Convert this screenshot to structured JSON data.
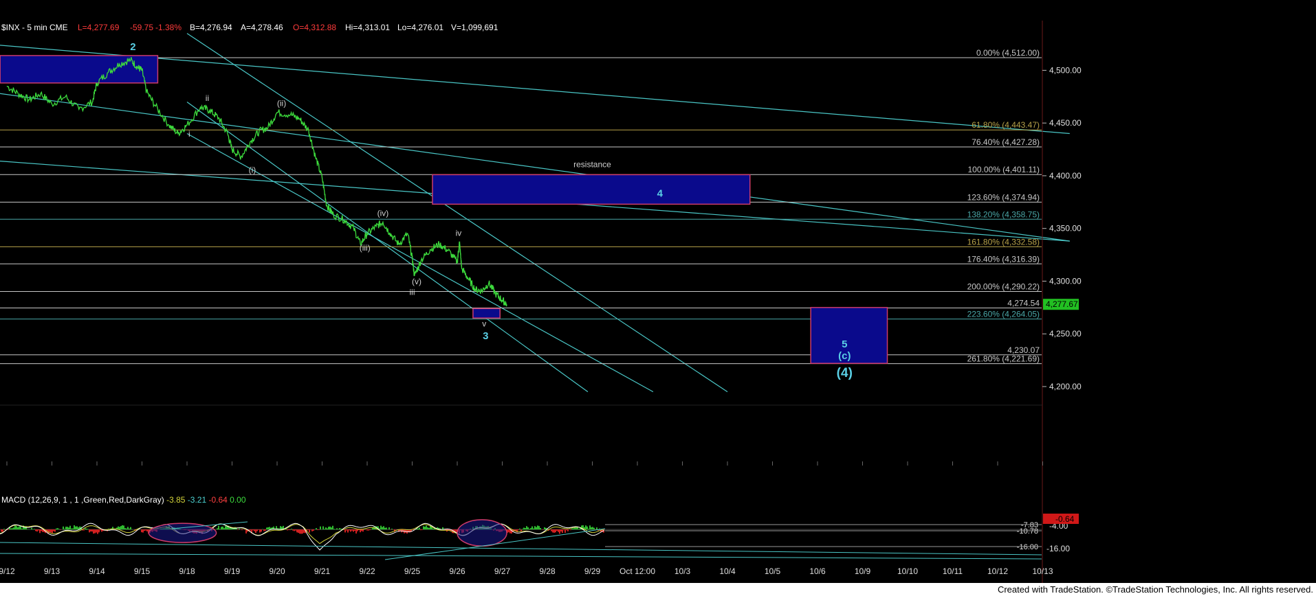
{
  "header": {
    "symbol": "$INX - 5 min  CME",
    "last": "L=4,277.69",
    "change": "-59.75",
    "pct": "-1.38%",
    "bid": "B=4,276.94",
    "ask": "A=4,278.46",
    "open": "O=4,312.88",
    "high": "Hi=4,313.01",
    "low": "Lo=4,276.01",
    "volume": "V=1,099,691"
  },
  "colors": {
    "background": "#000000",
    "price": "#3ddc3d",
    "trendline": "#4ac7c7",
    "fib": "#c8c8c8",
    "fib_gold": "#b7a24a",
    "box_fill": "#0a0a8c",
    "box_edge": "#cc3b6a",
    "wave_cyan": "#5ad0e6",
    "wave_white": "#d0d0d0"
  },
  "chart_data": {
    "type": "line",
    "title": "$INX - 5 min  CME",
    "x": [
      "9/12",
      "9/13",
      "9/14",
      "9/15",
      "9/18",
      "9/19",
      "9/20",
      "9/21",
      "9/22",
      "9/25",
      "9/26",
      "9/27",
      "9/28",
      "9/29",
      "Oct 12:00",
      "10/3",
      "10/4",
      "10/5",
      "10/6",
      "10/9",
      "10/10",
      "10/11",
      "10/12",
      "10/13"
    ],
    "series": [
      {
        "name": "$INX",
        "points": [
          [
            0.0,
            4485
          ],
          [
            0.25,
            4478
          ],
          [
            0.5,
            4472
          ],
          [
            0.75,
            4478
          ],
          [
            1.0,
            4468
          ],
          [
            1.3,
            4475
          ],
          [
            1.6,
            4463
          ],
          [
            1.9,
            4470
          ],
          [
            2.0,
            4488
          ],
          [
            2.25,
            4498
          ],
          [
            2.5,
            4506
          ],
          [
            2.75,
            4510
          ],
          [
            2.9,
            4503
          ],
          [
            3.0,
            4500
          ],
          [
            3.1,
            4480
          ],
          [
            3.3,
            4466
          ],
          [
            3.6,
            4448
          ],
          [
            3.8,
            4440
          ],
          [
            4.0,
            4448
          ],
          [
            4.3,
            4465
          ],
          [
            4.5,
            4462
          ],
          [
            4.7,
            4455
          ],
          [
            4.9,
            4440
          ],
          [
            5.0,
            4425
          ],
          [
            5.2,
            4418
          ],
          [
            5.4,
            4432
          ],
          [
            5.6,
            4442
          ],
          [
            5.8,
            4446
          ],
          [
            6.0,
            4460
          ],
          [
            6.3,
            4458
          ],
          [
            6.5,
            4454
          ],
          [
            6.7,
            4443
          ],
          [
            6.85,
            4418
          ],
          [
            7.0,
            4398
          ],
          [
            7.1,
            4372
          ],
          [
            7.25,
            4363
          ],
          [
            7.5,
            4358
          ],
          [
            7.7,
            4350
          ],
          [
            7.85,
            4335
          ],
          [
            8.0,
            4345
          ],
          [
            8.2,
            4352
          ],
          [
            8.35,
            4356
          ],
          [
            8.5,
            4346
          ],
          [
            8.7,
            4335
          ],
          [
            8.9,
            4345
          ],
          [
            9.0,
            4322
          ],
          [
            9.05,
            4305
          ],
          [
            9.2,
            4320
          ],
          [
            9.4,
            4330
          ],
          [
            9.6,
            4335
          ],
          [
            9.8,
            4329
          ],
          [
            10.0,
            4318
          ],
          [
            10.05,
            4337
          ],
          [
            10.1,
            4312
          ],
          [
            10.25,
            4302
          ],
          [
            10.4,
            4292
          ],
          [
            10.55,
            4291
          ],
          [
            10.7,
            4298
          ],
          [
            10.85,
            4288
          ],
          [
            11.0,
            4282
          ],
          [
            11.1,
            4278
          ]
        ]
      },
      {
        "name": "MACD (12,26,9, 1 , 1 ,Green,Red,DarkGray)",
        "values": [
          "-3.85",
          "-3.21",
          "-0.64",
          "0.00"
        ]
      }
    ],
    "ylim": [
      4185,
      4540
    ],
    "y_ticks": [
      "4,500.00",
      "4,450.00",
      "4,400.00",
      "4,350.00",
      "4,300.00",
      "4,250.00",
      "4,200.00"
    ],
    "current_price_tag": "4,277.67",
    "fib_levels": [
      {
        "label": "0.00% (4,512.00)",
        "value": 4512.0,
        "tone": "fib"
      },
      {
        "label": "61.80% (4,443.47)",
        "value": 4443.47,
        "tone": "fib_gold"
      },
      {
        "label": "76.40% (4,427.28)",
        "value": 4427.28,
        "tone": "fib"
      },
      {
        "label": "100.00% (4,401.11)",
        "value": 4401.11,
        "tone": "fib"
      },
      {
        "label": "123.60% (4,374.94)",
        "value": 4374.94,
        "tone": "fib"
      },
      {
        "label": "138.20% (4,358.75)",
        "value": 4358.75,
        "tone": "fib_teal"
      },
      {
        "label": "161.80% (4,332.58)",
        "value": 4332.58,
        "tone": "fib_gold"
      },
      {
        "label": "176.40% (4,316.39)",
        "value": 4316.39,
        "tone": "fib"
      },
      {
        "label": "200.00% (4,290.22)",
        "value": 4290.22,
        "tone": "fib"
      },
      {
        "label": "4,274.54",
        "value": 4274.54,
        "tone": "fib"
      },
      {
        "label": "223.60% (4,264.05)",
        "value": 4264.05,
        "tone": "fib_teal"
      },
      {
        "label": "4,230.07",
        "value": 4230.07,
        "tone": "fib"
      },
      {
        "label": "261.80% (4,221.69)",
        "value": 4221.69,
        "tone": "fib"
      }
    ],
    "annotations": [
      {
        "text": "2",
        "x": 2.8,
        "y": 4519,
        "kind": "cyan_small"
      },
      {
        "text": "ii",
        "x": 4.45,
        "y": 4471,
        "kind": "white"
      },
      {
        "text": "i",
        "x": 4.05,
        "y": 4437,
        "kind": "white"
      },
      {
        "text": "(ii)",
        "x": 6.1,
        "y": 4466,
        "kind": "white"
      },
      {
        "text": "(i)",
        "x": 5.45,
        "y": 4403,
        "kind": "white"
      },
      {
        "text": "(iv)",
        "x": 8.35,
        "y": 4362,
        "kind": "white"
      },
      {
        "text": "(iii)",
        "x": 7.95,
        "y": 4329,
        "kind": "white"
      },
      {
        "text": "(v)",
        "x": 9.1,
        "y": 4297,
        "kind": "white"
      },
      {
        "text": "iii",
        "x": 9.0,
        "y": 4287,
        "kind": "white"
      },
      {
        "text": "iv",
        "x": 10.03,
        "y": 4343,
        "kind": "white"
      },
      {
        "text": "v",
        "x": 10.6,
        "y": 4257,
        "kind": "white"
      },
      {
        "text": "3",
        "x": 10.63,
        "y": 4245,
        "kind": "cyan_small"
      },
      {
        "text": "resistance",
        "x": 13.0,
        "y": 4408,
        "kind": "white"
      },
      {
        "text": "4",
        "x": 14.5,
        "y": 4380,
        "kind": "cyan_small"
      },
      {
        "text": "5",
        "x": 18.6,
        "y": 4237,
        "kind": "cyan_small"
      },
      {
        "text": "(c)",
        "x": 18.6,
        "y": 4226,
        "kind": "cyan_small"
      },
      {
        "text": "(4)",
        "x": 18.6,
        "y": 4209,
        "kind": "cyan_big"
      }
    ],
    "boxes": [
      {
        "x0": -0.15,
        "x1": 3.35,
        "y0": 4488,
        "y1": 4514
      },
      {
        "x0": 9.45,
        "x1": 16.5,
        "y0": 4373,
        "y1": 4401
      },
      {
        "x0": 10.35,
        "x1": 10.95,
        "y0": 4265,
        "y1": 4274
      },
      {
        "x0": 17.85,
        "x1": 19.55,
        "y0": 4222,
        "y1": 4275
      }
    ],
    "trendlines": [
      {
        "points": [
          [
            -0.5,
            4525
          ],
          [
            23.6,
            4440
          ]
        ]
      },
      {
        "points": [
          [
            -0.5,
            4480
          ],
          [
            23.6,
            4338
          ]
        ]
      },
      {
        "points": [
          [
            -0.5,
            4415
          ],
          [
            23.6,
            4338
          ]
        ]
      },
      {
        "points": [
          [
            4.0,
            4535
          ],
          [
            16.0,
            4195
          ]
        ]
      },
      {
        "points": [
          [
            4.0,
            4470
          ],
          [
            12.9,
            4195
          ]
        ]
      },
      {
        "points": [
          [
            4.0,
            4440
          ],
          [
            14.35,
            4195
          ]
        ]
      }
    ],
    "macd": {
      "ylim": [
        -18,
        4
      ],
      "y_ticks": [
        "-7.83",
        "-10.78",
        "-16.00"
      ],
      "current_tag": "-0.64",
      "ellipses": [
        {
          "cx": 3.9,
          "cy": -4.3,
          "rx": 0.75,
          "ry": 3.5
        },
        {
          "cx": 10.55,
          "cy": -4.5,
          "rx": 0.55,
          "ry": 4.8
        }
      ]
    },
    "grid": false
  },
  "footer": {
    "credit": "Created with TradeStation. ©TradeStation Technologies, Inc. All rights reserved."
  }
}
